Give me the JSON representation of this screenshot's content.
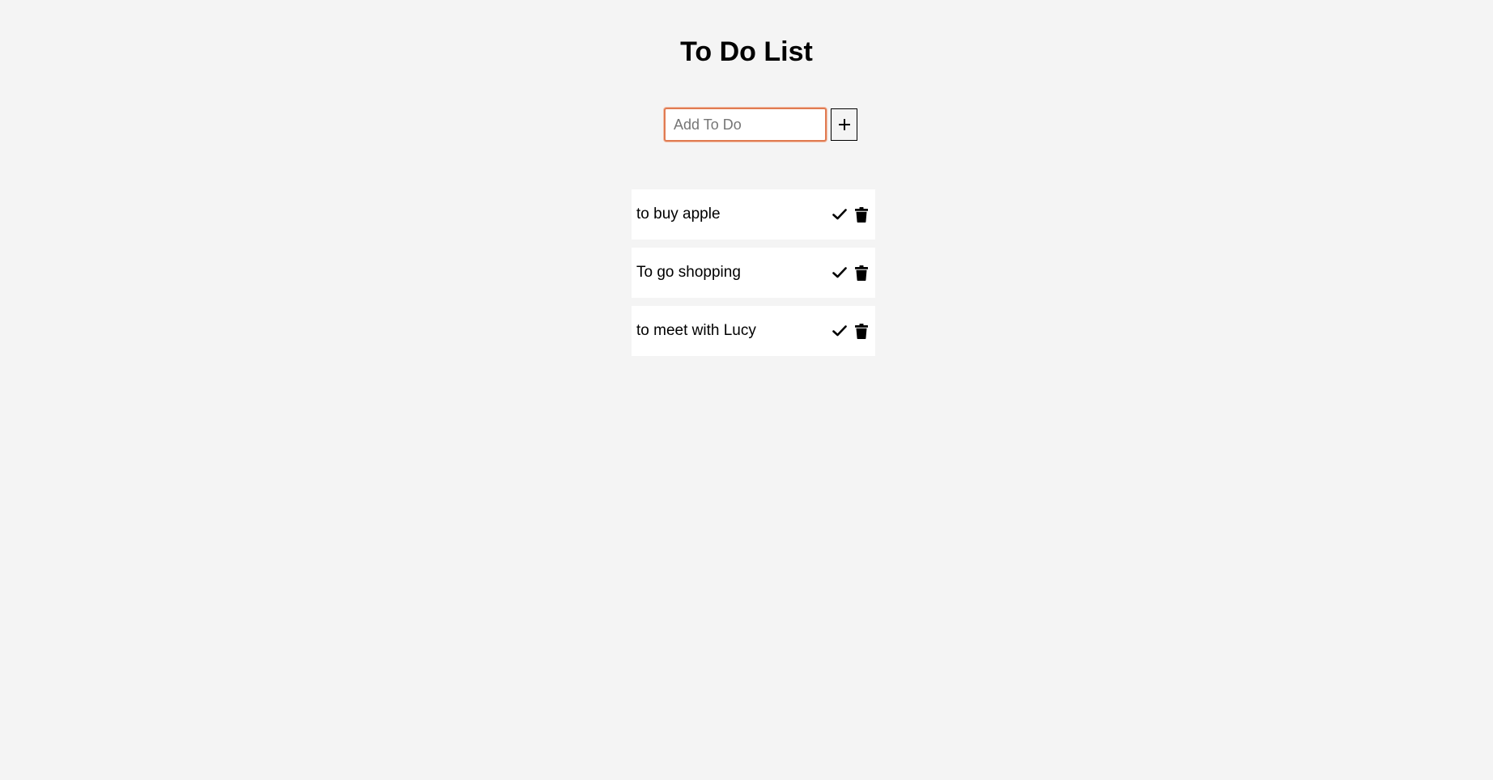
{
  "header": {
    "title": "To Do List"
  },
  "add_form": {
    "input_value": "",
    "input_placeholder": "Add To Do",
    "add_button_icon": "plus-icon"
  },
  "todos": [
    {
      "text": "to buy apple",
      "complete_icon": "check-icon",
      "delete_icon": "trash-icon"
    },
    {
      "text": "To go shopping",
      "complete_icon": "check-icon",
      "delete_icon": "trash-icon"
    },
    {
      "text": "to meet with Lucy",
      "complete_icon": "check-icon",
      "delete_icon": "trash-icon"
    }
  ],
  "colors": {
    "background": "#f4f4f4",
    "item_background": "#ffffff",
    "input_focus_border": "#e07b52",
    "text": "#000000"
  }
}
